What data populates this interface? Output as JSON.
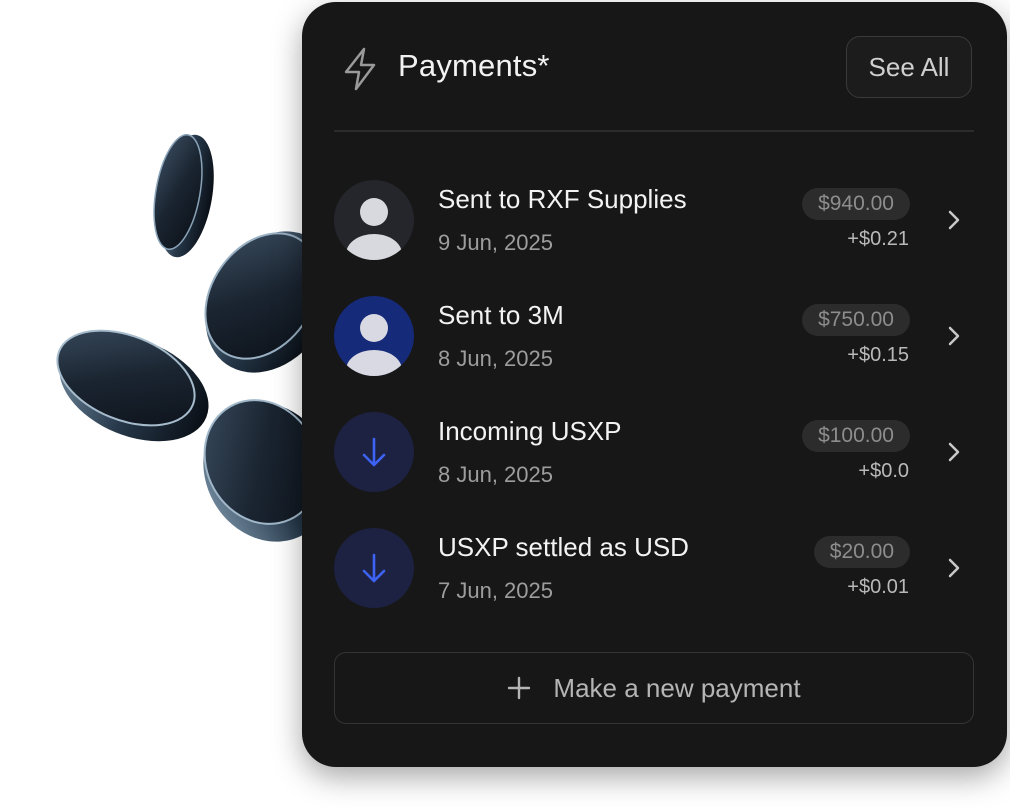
{
  "colors": {
    "card_bg": "#171717",
    "pill_bg": "#2c2c2c",
    "avatar_gray_bg": "#25262c",
    "avatar_blue_bg": "#162a7a",
    "incoming_bg": "#1d2243",
    "arrow_blue": "#3d63f5"
  },
  "header": {
    "icon": "lightning-bolt-icon",
    "title": "Payments*",
    "see_all_label": "See All"
  },
  "payments": [
    {
      "title": "Sent to RXF Supplies",
      "date": "9 Jun, 2025",
      "amount": "$940.00",
      "fee": "+$0.21",
      "icon": "person-avatar-icon",
      "avatar_style": "gray"
    },
    {
      "title": "Sent to 3M",
      "date": "8 Jun, 2025",
      "amount": "$750.00",
      "fee": "+$0.15",
      "icon": "person-avatar-icon",
      "avatar_style": "blue"
    },
    {
      "title": "Incoming USXP",
      "date": "8 Jun, 2025",
      "amount": "$100.00",
      "fee": "+$0.0",
      "icon": "arrow-down-icon",
      "avatar_style": "incoming"
    },
    {
      "title": "USXP settled as USD",
      "date": "7 Jun, 2025",
      "amount": "$20.00",
      "fee": "+$0.01",
      "icon": "arrow-down-icon",
      "avatar_style": "incoming"
    }
  ],
  "new_payment": {
    "icon": "plus-icon",
    "label": "Make a new payment"
  }
}
